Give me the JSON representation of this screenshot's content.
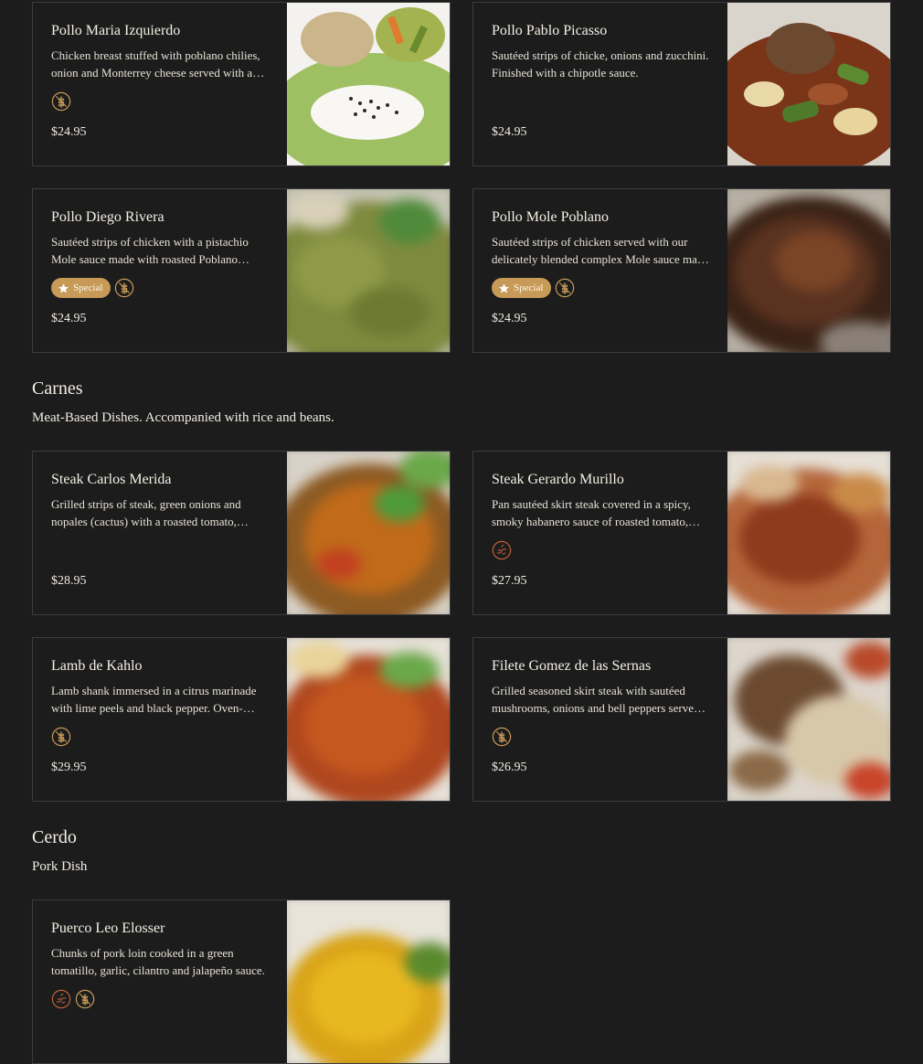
{
  "colors": {
    "background": "#1c1c1c",
    "card_border": "#3c3c3c",
    "badge": "#c79a58",
    "spicy_icon": "#c0613a",
    "text": "#f2ede4"
  },
  "sections": [
    {
      "items": [
        {
          "title": "Pollo Maria Izquierdo",
          "description": "Chicken breast stuffed with poblano chilies, onion and Monterrey cheese served with a creamy poblano sauce.",
          "badges": [
            "gluten-free-icon"
          ],
          "price": "$24.95"
        },
        {
          "title": "Pollo Pablo Picasso",
          "description": "Sautéed strips of chicke, onions and zucchini. Finished with a chipotle sauce.",
          "badges": [],
          "price": "$24.95"
        },
        {
          "title": "Pollo Diego Rivera",
          "description": "Sautéed strips of chicken with a pistachio Mole sauce made with roasted Poblano peppers.",
          "special": "Special",
          "badges": [
            "gluten-free-icon"
          ],
          "price": "$24.95"
        },
        {
          "title": "Pollo Mole Poblano",
          "description": "Sautéed strips of chicken served with our delicately blended complex Mole sauce made with chilies and chocolate.",
          "special": "Special",
          "badges": [
            "gluten-free-icon"
          ],
          "price": "$24.95"
        }
      ]
    },
    {
      "title": "Carnes",
      "description": "Meat-Based Dishes. Accompanied with rice and beans.",
      "items": [
        {
          "title": "Steak Carlos Merida",
          "description": "Grilled strips of steak, green onions and nopales (cactus) with a roasted tomato, chipotle sauce.",
          "badges": [],
          "price": "$28.95"
        },
        {
          "title": "Steak Gerardo Murillo",
          "description": "Pan sautéed skirt steak covered in a spicy, smoky habanero sauce of roasted tomato, onion and garlic.",
          "badges": [
            "spicy-icon"
          ],
          "price": "$27.95"
        },
        {
          "title": "Lamb de Kahlo",
          "description": "Lamb shank immersed in a citrus marinade with lime peels and black pepper. Oven-roasted until tender.",
          "badges": [
            "gluten-free-icon"
          ],
          "price": "$29.95"
        },
        {
          "title": "Filete Gomez de las Sernas",
          "description": "Grilled seasoned skirt steak with sautéed mushrooms, onions and bell peppers served with rice.",
          "badges": [
            "gluten-free-icon"
          ],
          "price": "$26.95"
        }
      ]
    },
    {
      "title": "Cerdo",
      "description": "Pork Dish",
      "items": [
        {
          "title": "Puerco Leo Elosser",
          "description": "Chunks of pork loin cooked in a green tomatillo, garlic, cilantro and jalapeño sauce.",
          "badges": [
            "spicy-icon",
            "gluten-free-icon"
          ],
          "price": ""
        }
      ]
    }
  ]
}
